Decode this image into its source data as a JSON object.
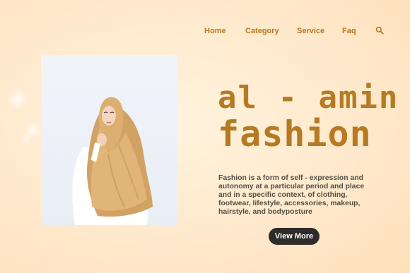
{
  "nav": {
    "items": [
      {
        "label": "Home"
      },
      {
        "label": "Category"
      },
      {
        "label": "Service"
      },
      {
        "label": "Faq"
      }
    ],
    "search_icon": "search-icon"
  },
  "hero": {
    "title_line1": "al - amin",
    "title_line2": "fashion",
    "description": "Fashion is a form of self - expression and autonomy at a particular period and place and in a specific context, of clothing, footwear, lifestyle, accessories, makeup, hairstyle, and bodyposture",
    "button_label": "View More"
  },
  "colors": {
    "accent": "#b57a22",
    "background": "#ffe9cc",
    "button": "#2f2c2a",
    "hijab": "#d9ad70"
  }
}
